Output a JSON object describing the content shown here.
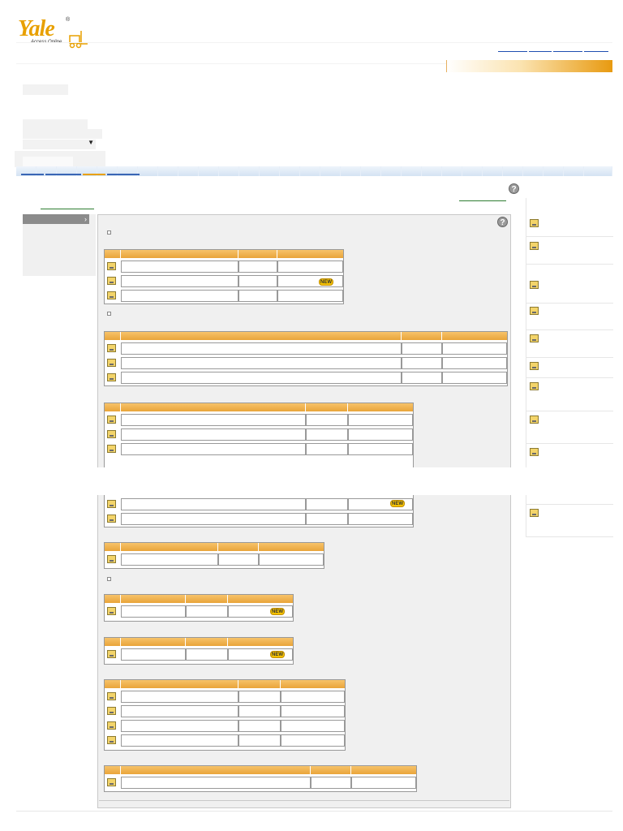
{
  "brand": {
    "logo_text": "Yale",
    "logo_subtitle": "Access Online",
    "registered_mark": "®",
    "accent_color": "#e8a000"
  },
  "icons": {
    "help": "help-icon",
    "document": "document-icon",
    "collapse": "collapse-icon",
    "dropdown": "dropdown-arrow-icon",
    "nav_arrow": "chevron-right-icon"
  },
  "help_glyph": "?",
  "dropdown_glyph": "▼",
  "nav_arrow_glyph": "›",
  "badges": {
    "new": "NEW"
  }
}
